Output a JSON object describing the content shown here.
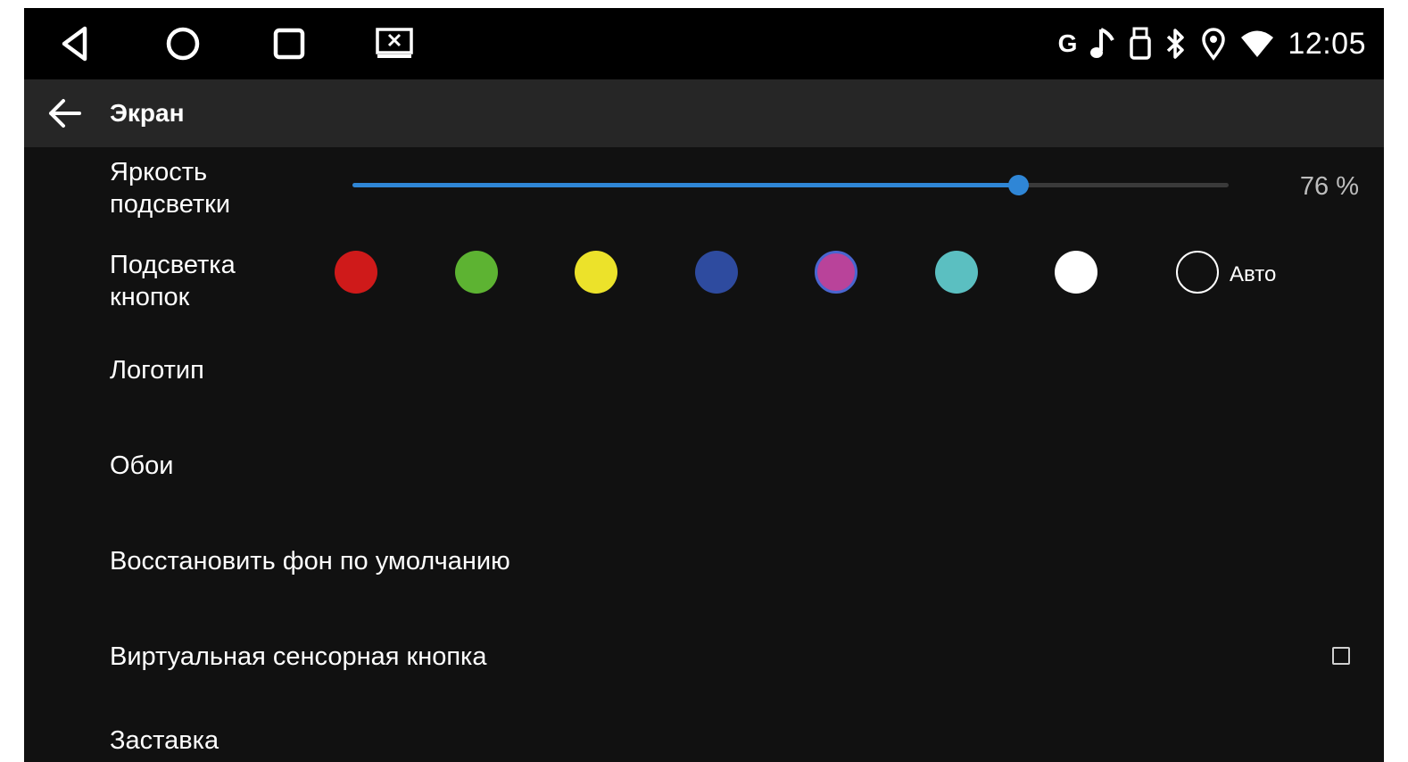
{
  "status_bar": {
    "nav_icons": [
      "back-triangle-icon",
      "home-circle-icon",
      "recents-square-icon",
      "screen-close-icon"
    ],
    "indicators": [
      "google-icon",
      "music-note-icon",
      "usb-icon",
      "bluetooth-icon",
      "location-icon",
      "wifi-icon"
    ],
    "google_letter": "G",
    "time": "12:05"
  },
  "toolbar": {
    "back_icon": "arrow-left-icon",
    "title": "Экран"
  },
  "brightness": {
    "label_line1": "Яркость",
    "label_line2": "подсветки",
    "value": 0.76,
    "value_text": "76 %",
    "accent_color": "#2f86d6"
  },
  "button_backlight": {
    "label_line1": "Подсветка",
    "label_line2": "кнопок",
    "colors": [
      "#cf1a1a",
      "#5db332",
      "#ece22a",
      "#2e4b9f",
      "#b9439a",
      "#5bbfc1",
      "#ffffff"
    ],
    "selected_index": 4,
    "auto_label": "Авто"
  },
  "settings": {
    "logo": "Логотип",
    "wallpaper": "Обои",
    "restore_default_bg": "Восстановить фон по умолчанию",
    "virtual_touch_button": "Виртуальная сенсорная кнопка",
    "virtual_touch_button_checked": false,
    "screensaver": "Заставка"
  }
}
